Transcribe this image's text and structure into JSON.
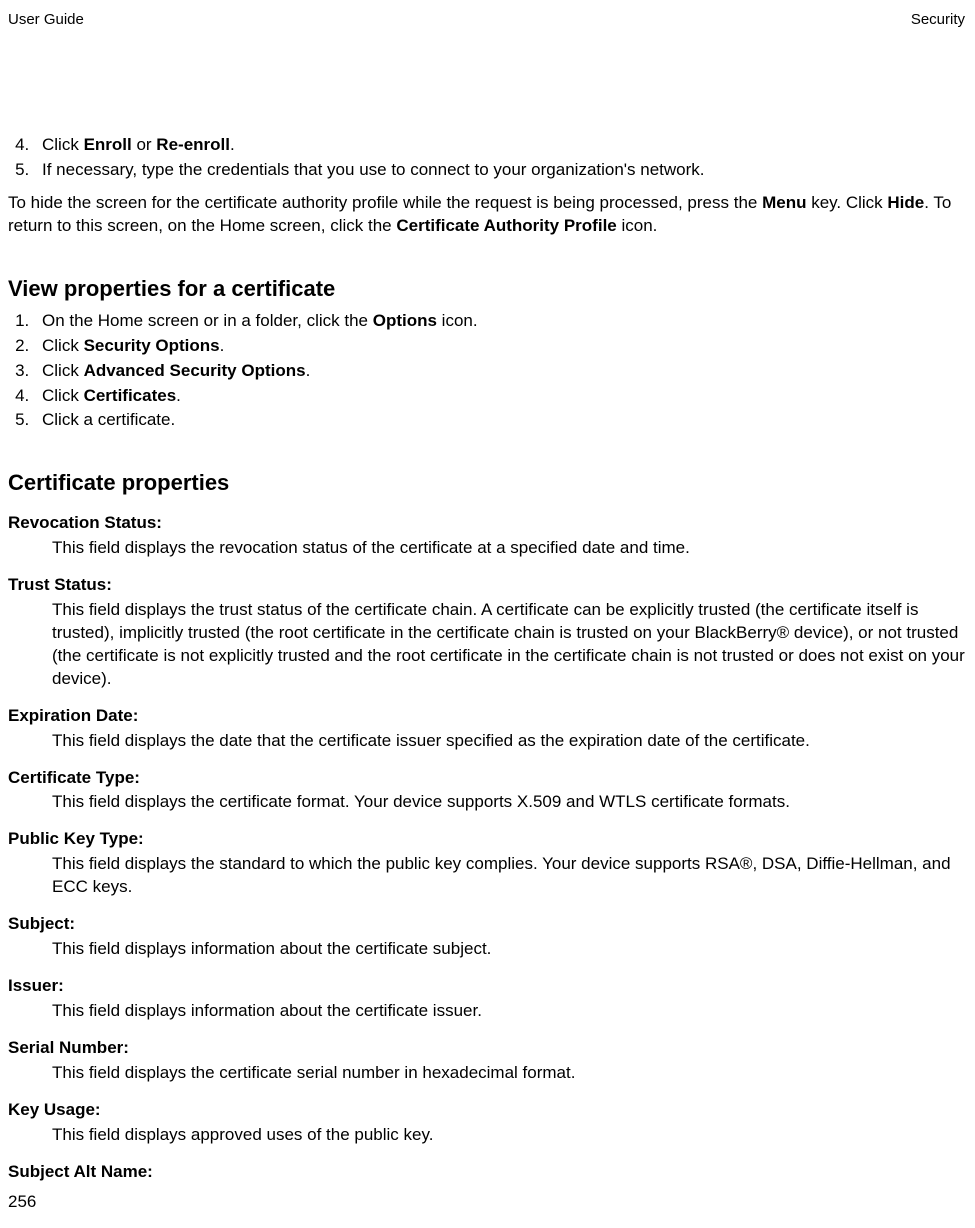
{
  "header": {
    "left": "User Guide",
    "right": "Security"
  },
  "steps1": {
    "start": 4,
    "items": [
      {
        "pre": "Click ",
        "b1": "Enroll",
        "mid": " or ",
        "b2": "Re-enroll",
        "post": "."
      },
      {
        "text": "If necessary, type the credentials that you use to connect to your organization's network."
      }
    ]
  },
  "para1": {
    "pre": "To hide the screen for the certificate authority profile while the request is being processed, press the ",
    "b1": "Menu",
    "mid1": " key. Click ",
    "b2": "Hide",
    "mid2": ". To return to this screen, on the Home screen, click the ",
    "b3": "Certificate Authority Profile",
    "post": " icon."
  },
  "section2": {
    "title": "View properties for a certificate",
    "steps": {
      "start": 1,
      "items": [
        {
          "pre": "On the Home screen or in a folder, click the ",
          "b1": "Options",
          "post": " icon."
        },
        {
          "pre": "Click ",
          "b1": "Security Options",
          "post": "."
        },
        {
          "pre": "Click ",
          "b1": "Advanced Security Options",
          "post": "."
        },
        {
          "pre": "Click ",
          "b1": "Certificates",
          "post": "."
        },
        {
          "text": "Click a certificate."
        }
      ]
    }
  },
  "section3": {
    "title": "Certificate properties",
    "defs": [
      {
        "term": "Revocation Status:",
        "desc": "This field displays the revocation status of the certificate at a specified date and time."
      },
      {
        "term": "Trust Status:",
        "desc": "This field displays the trust status of the certificate chain. A certificate can be explicitly trusted (the certificate itself is trusted), implicitly trusted (the root certificate in the certificate chain is trusted on your BlackBerry® device), or not trusted (the certificate is not explicitly trusted and the root certificate in the certificate chain is not trusted or does not exist on your device)."
      },
      {
        "term": "Expiration Date:",
        "desc": "This field displays the date that the certificate issuer specified as the expiration date of the certificate."
      },
      {
        "term": "Certificate Type:",
        "desc": "This field displays the certificate format. Your device supports X.509 and WTLS certificate formats."
      },
      {
        "term": "Public Key Type:",
        "desc": "This field displays the standard to which the public key complies. Your device supports RSA®, DSA, Diffie-Hellman, and ECC keys."
      },
      {
        "term": "Subject:",
        "desc": "This field displays information about the certificate subject."
      },
      {
        "term": "Issuer:",
        "desc": "This field displays information about the certificate issuer."
      },
      {
        "term": "Serial Number:",
        "desc": "This field displays the certificate serial number in hexadecimal format."
      },
      {
        "term": "Key Usage:",
        "desc": "This field displays approved uses of the public key."
      },
      {
        "term": "Subject Alt Name:",
        "desc": ""
      }
    ]
  },
  "footer": {
    "page": "256"
  }
}
